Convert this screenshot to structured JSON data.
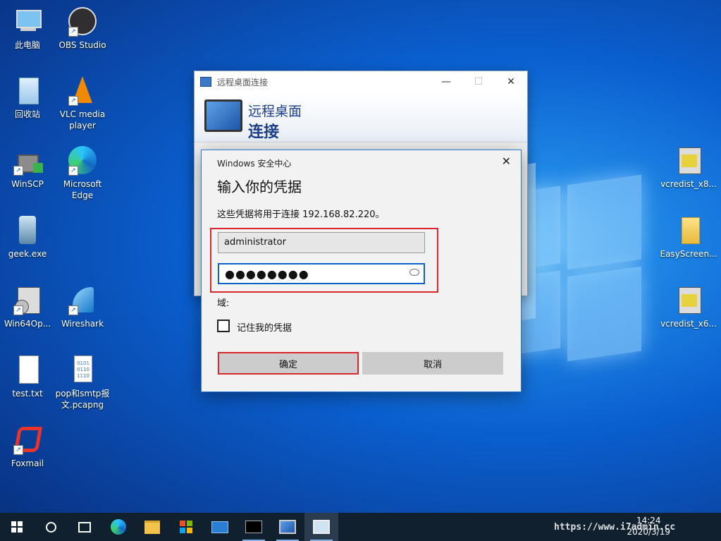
{
  "desktop_icons": [
    {
      "label": "此电脑"
    },
    {
      "label": "OBS Studio"
    },
    {
      "label": "回收站"
    },
    {
      "label": "VLC media player"
    },
    {
      "label": "WinSCP"
    },
    {
      "label": "Microsoft Edge"
    },
    {
      "label": "geek.exe"
    },
    {
      "label": "Win64Op..."
    },
    {
      "label": "Wireshark"
    },
    {
      "label": "test.txt"
    },
    {
      "label": "pop和smtp报文.pcapng"
    },
    {
      "label": "Foxmail"
    },
    {
      "label": "vcredist_x8..."
    },
    {
      "label": "EasyScreen..."
    },
    {
      "label": "vcredist_x6..."
    }
  ],
  "rdc_window": {
    "title": "远程桌面连接",
    "banner_line1": "远程桌面",
    "banner_line2": "连接",
    "minimize": "—",
    "maximize": "☐",
    "close": "✕"
  },
  "credential_dialog": {
    "header": "Windows 安全中心",
    "heading": "输入你的凭据",
    "description": "这些凭据将用于连接 192.168.82.220。",
    "username": "administrator",
    "password_mask": "●●●●●●●●",
    "domain_label": "域:",
    "remember_label": "记住我的凭据",
    "ok_label": "确定",
    "cancel_label": "取消",
    "close": "✕"
  },
  "taskbar": {
    "time": "14:24",
    "date": "2020/3/19",
    "watermark": "https://www.i7admin.cc"
  },
  "colors": {
    "accent": "#0a64c8",
    "highlight_red": "#d9272e",
    "taskbar": "#10202e"
  }
}
